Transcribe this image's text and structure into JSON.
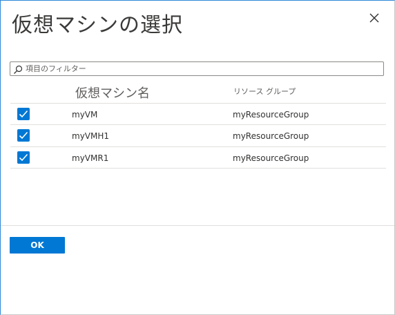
{
  "dialog": {
    "title": "仮想マシンの選択",
    "close_icon": "close-icon"
  },
  "filter": {
    "placeholder": "項目のフィルター",
    "value": "",
    "icon": "search-icon"
  },
  "table": {
    "columns": {
      "name": "仮想マシン名",
      "resource_group": "リソース グループ"
    },
    "rows": [
      {
        "checked": true,
        "vm_name": "myVM",
        "resource_group": "myResourceGroup"
      },
      {
        "checked": true,
        "vm_name": "myVMH1",
        "resource_group": "myResourceGroup"
      },
      {
        "checked": true,
        "vm_name": "myVMR1",
        "resource_group": "myResourceGroup"
      }
    ]
  },
  "footer": {
    "ok_label": "OK"
  },
  "colors": {
    "accent": "#0078d4",
    "border": "#8a8886",
    "divider": "#e1dfdd",
    "text": "#323130"
  }
}
